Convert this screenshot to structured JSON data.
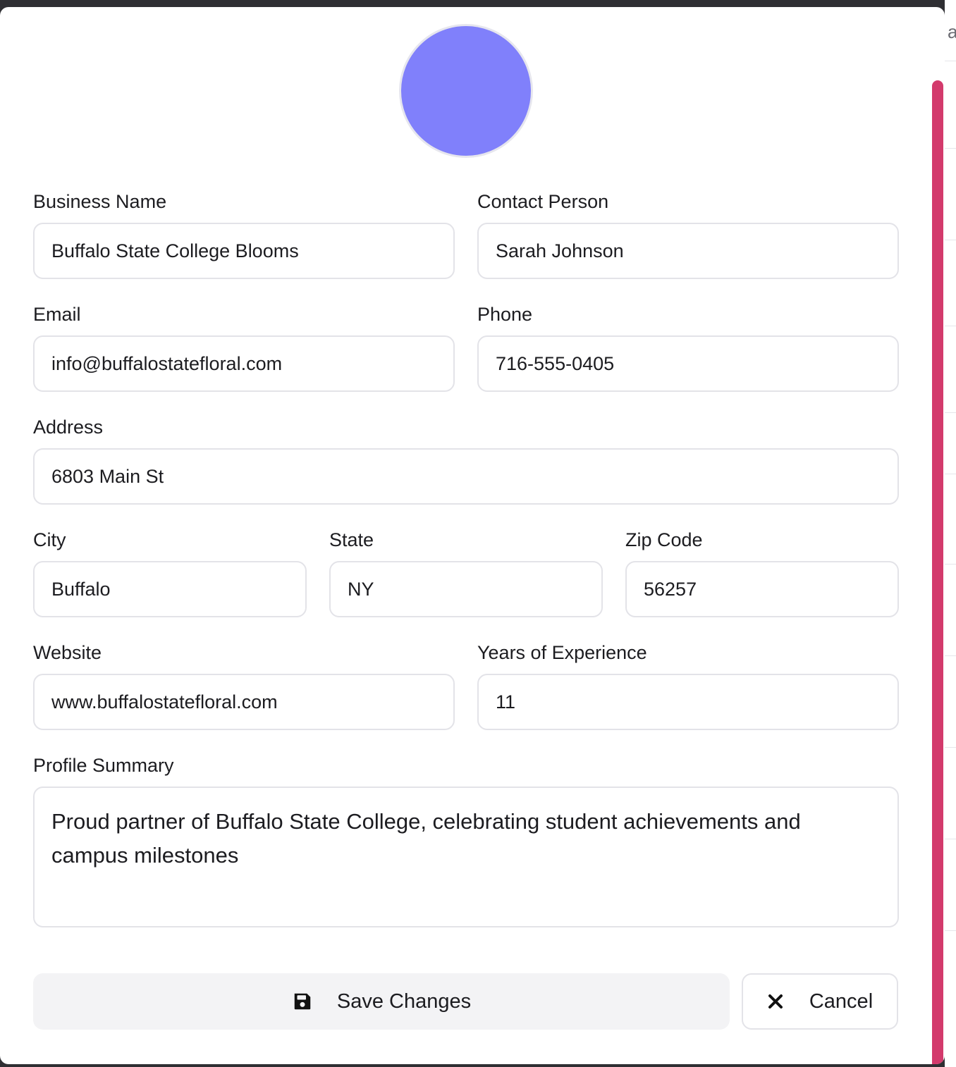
{
  "form": {
    "business_name": {
      "label": "Business Name",
      "value": "Buffalo State College Blooms"
    },
    "contact_person": {
      "label": "Contact Person",
      "value": "Sarah Johnson"
    },
    "email": {
      "label": "Email",
      "value": "info@buffalostatefloral.com"
    },
    "phone": {
      "label": "Phone",
      "value": "716-555-0405"
    },
    "address": {
      "label": "Address",
      "value": "6803 Main St"
    },
    "city": {
      "label": "City",
      "value": "Buffalo"
    },
    "state": {
      "label": "State",
      "value": "NY"
    },
    "zip": {
      "label": "Zip Code",
      "value": "56257"
    },
    "website": {
      "label": "Website",
      "value": "www.buffalostatefloral.com"
    },
    "experience": {
      "label": "Years of Experience",
      "value": "11"
    },
    "summary": {
      "label": "Profile Summary",
      "value": "Proud partner of Buffalo State College, celebrating student achievements and campus milestones"
    }
  },
  "actions": {
    "save_label": "Save Changes",
    "save_icon": "floppy-disk-icon",
    "cancel_label": "Cancel",
    "cancel_icon": "close-icon"
  },
  "colors": {
    "avatar": "#8080fb",
    "scrollbar": "#d33a6c",
    "save_button_bg": "#f3f3f5"
  }
}
